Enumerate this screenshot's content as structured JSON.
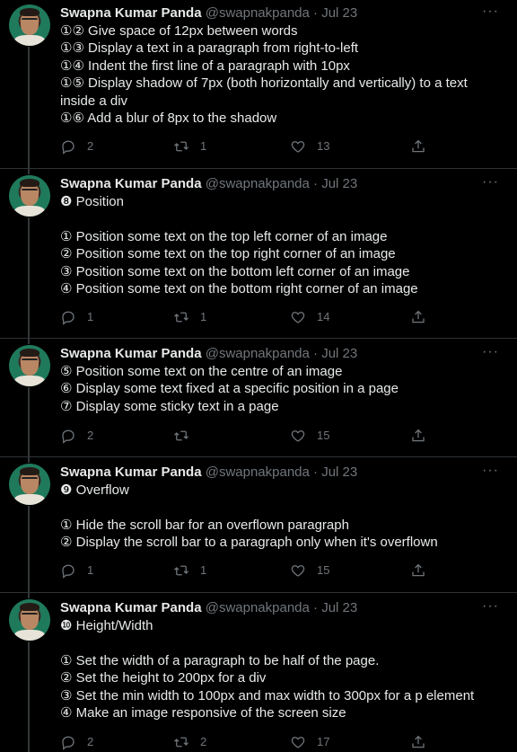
{
  "author": {
    "name": "Swapna Kumar Panda",
    "handle": "@swapnakpanda",
    "separator": "·",
    "date": "Jul 23"
  },
  "more_label": "···",
  "tweets": [
    {
      "lines": [
        "①② Give space of 12px between words",
        "①③ Display a text in a paragraph from right-to-left",
        "①④ Indent the first line of a paragraph with 10px",
        "①⑤ Display shadow of 7px (both horizontally and vertically) to a text inside a div",
        "①⑥ Add a blur of 8px to the shadow"
      ],
      "replies": "2",
      "retweets": "1",
      "likes": "13"
    },
    {
      "lines": [
        "❽ Position",
        "",
        "① Position some text on the top left corner of an image",
        "② Position some text on the top right corner of an image",
        "③ Position some text on the bottom left corner of an image",
        "④ Position some text on the bottom right corner of an image"
      ],
      "replies": "1",
      "retweets": "1",
      "likes": "14"
    },
    {
      "lines": [
        "⑤ Position some text on the centre of an image",
        "⑥ Display some text fixed at a specific position in a page",
        "⑦ Display some sticky text in a page"
      ],
      "replies": "2",
      "retweets": "",
      "likes": "15"
    },
    {
      "lines": [
        "❾ Overflow",
        "",
        "① Hide the scroll bar for an overflown paragraph",
        "② Display the scroll bar to a paragraph only when it's overflown"
      ],
      "replies": "1",
      "retweets": "1",
      "likes": "15"
    },
    {
      "lines": [
        "❿ Height/Width",
        "",
        "① Set the width of a paragraph to be half of the page.",
        "② Set the height to 200px for a div",
        "③ Set the min width to 100px and max width to 300px for a p element",
        "④ Make an image responsive of the screen size"
      ],
      "replies": "2",
      "retweets": "2",
      "likes": "17"
    }
  ]
}
